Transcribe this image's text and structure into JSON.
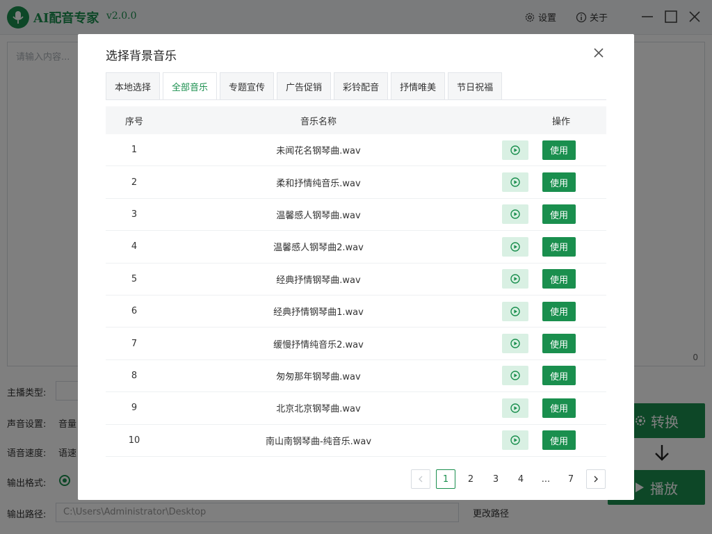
{
  "app": {
    "title": "AI配音专家",
    "version": "v2.0.0",
    "settings_label": "设置",
    "about_label": "关于",
    "text_placeholder": "请输入内容...",
    "char_count": "0",
    "form": {
      "anchor_type_label": "主播类型:",
      "voice_settings_label": "声音设置:",
      "voice_volume_label": "音量",
      "speech_speed_label": "语音速度:",
      "speed_sub_label": "语速",
      "output_format_label": "输出格式:",
      "output_path_label": "输出路径:",
      "output_path_value": "C:\\Users\\Administrator\\Desktop",
      "change_path_label": "更改路径"
    },
    "convert_label": "转换",
    "play_label": "播放",
    "brand_color": "#1a8f4e"
  },
  "dialog": {
    "title": "选择背景音乐",
    "tabs": [
      {
        "label": "本地选择",
        "active": false
      },
      {
        "label": "全部音乐",
        "active": true
      },
      {
        "label": "专题宣传",
        "active": false
      },
      {
        "label": "广告促销",
        "active": false
      },
      {
        "label": "彩铃配音",
        "active": false
      },
      {
        "label": "抒情唯美",
        "active": false
      },
      {
        "label": "节日祝福",
        "active": false
      }
    ],
    "table": {
      "headers": {
        "no": "序号",
        "name": "音乐名称",
        "op": "操作"
      },
      "use_label": "使用",
      "rows": [
        {
          "no": "1",
          "name": "未闻花名钢琴曲.wav"
        },
        {
          "no": "2",
          "name": "柔和抒情纯音乐.wav"
        },
        {
          "no": "3",
          "name": "温馨感人钢琴曲.wav"
        },
        {
          "no": "4",
          "name": "温馨感人钢琴曲2.wav"
        },
        {
          "no": "5",
          "name": "经典抒情钢琴曲.wav"
        },
        {
          "no": "6",
          "name": "经典抒情钢琴曲1.wav"
        },
        {
          "no": "7",
          "name": "缓慢抒情纯音乐2.wav"
        },
        {
          "no": "8",
          "name": "匆匆那年钢琴曲.wav"
        },
        {
          "no": "9",
          "name": "北京北京钢琴曲.wav"
        },
        {
          "no": "10",
          "name": "南山南钢琴曲-纯音乐.wav"
        }
      ]
    },
    "pagination": {
      "pages": [
        "1",
        "2",
        "3",
        "4",
        "...",
        "7"
      ],
      "current": "1"
    }
  }
}
